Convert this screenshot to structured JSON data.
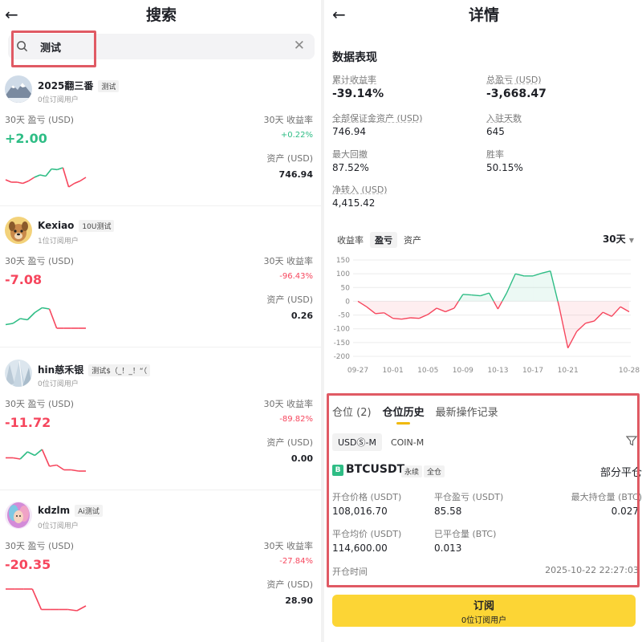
{
  "left": {
    "title": "搜索",
    "search": {
      "value": "测试",
      "placeholder": ""
    },
    "cards": [
      {
        "name": "2025翻三番",
        "tag": "测试",
        "subscribers": "0位订阅用户",
        "pnl_label": "30天 盈亏 (USD)",
        "pnl": "+2.00",
        "pnl_color": "#2ebd85",
        "roi_label": "30天 收益率",
        "roi": "+0.22%",
        "roi_color": "#2ebd85",
        "assets_label": "资产 (USD)",
        "assets": "746.94",
        "avatar": "mountain-avatar",
        "sparkline": [
          {
            "v": 0.3,
            "c": "#f6465d"
          },
          {
            "v": 0.2,
            "c": "#f6465d"
          },
          {
            "v": 0.2,
            "c": "#f6465d"
          },
          {
            "v": 0.15,
            "c": "#f6465d"
          },
          {
            "v": 0.25,
            "c": "#f6465d"
          },
          {
            "v": 0.4,
            "c": "#f6465d"
          },
          {
            "v": 0.5,
            "c": "#2ebd85"
          },
          {
            "v": 0.45,
            "c": "#2ebd85"
          },
          {
            "v": 0.75,
            "c": "#2ebd85"
          },
          {
            "v": 0.72,
            "c": "#2ebd85"
          },
          {
            "v": 0.8,
            "c": "#2ebd85"
          },
          {
            "v": 0.0,
            "c": "#f6465d"
          },
          {
            "v": 0.15,
            "c": "#f6465d"
          },
          {
            "v": 0.25,
            "c": "#f6465d"
          },
          {
            "v": 0.4,
            "c": "#f6465d"
          }
        ]
      },
      {
        "name": "Kexiao",
        "tag": "10U测试",
        "subscribers": "1位订阅用户",
        "pnl_label": "30天 盈亏 (USD)",
        "pnl": "-7.08",
        "pnl_color": "#f6465d",
        "roi_label": "30天 收益率",
        "roi": "-96.43%",
        "roi_color": "#f6465d",
        "assets_label": "资产 (USD)",
        "assets": "0.26",
        "avatar": "dog-avatar",
        "sparkline": [
          {
            "v": 0.15,
            "c": "#2ebd85"
          },
          {
            "v": 0.2,
            "c": "#2ebd85"
          },
          {
            "v": 0.4,
            "c": "#2ebd85"
          },
          {
            "v": 0.35,
            "c": "#2ebd85"
          },
          {
            "v": 0.65,
            "c": "#2ebd85"
          },
          {
            "v": 0.85,
            "c": "#2ebd85"
          },
          {
            "v": 0.8,
            "c": "#2ebd85"
          },
          {
            "v": 0.0,
            "c": "#f6465d"
          },
          {
            "v": 0.0,
            "c": "#f6465d"
          },
          {
            "v": 0.0,
            "c": "#f6465d"
          },
          {
            "v": 0.0,
            "c": "#f6465d"
          },
          {
            "v": 0.0,
            "c": "#f6465d"
          }
        ]
      },
      {
        "name": "hin慈禾银",
        "tag": "测试$（_！_！“（",
        "subscribers": "0位订阅用户",
        "pnl_label": "30天 盈亏 (USD)",
        "pnl": "-11.72",
        "pnl_color": "#f6465d",
        "roi_label": "30天 收益率",
        "roi": "-89.82%",
        "roi_color": "#f6465d",
        "assets_label": "资产 (USD)",
        "assets": "0.00",
        "avatar": "ice-avatar",
        "sparkline": [
          {
            "v": 0.55,
            "c": "#f6465d"
          },
          {
            "v": 0.55,
            "c": "#f6465d"
          },
          {
            "v": 0.5,
            "c": "#f6465d"
          },
          {
            "v": 0.8,
            "c": "#2ebd85"
          },
          {
            "v": 0.65,
            "c": "#2ebd85"
          },
          {
            "v": 0.9,
            "c": "#2ebd85"
          },
          {
            "v": 0.2,
            "c": "#f6465d"
          },
          {
            "v": 0.25,
            "c": "#f6465d"
          },
          {
            "v": 0.05,
            "c": "#f6465d"
          },
          {
            "v": 0.05,
            "c": "#f6465d"
          },
          {
            "v": 0.0,
            "c": "#f6465d"
          },
          {
            "v": 0.0,
            "c": "#f6465d"
          }
        ]
      },
      {
        "name": "kdzlm",
        "tag": "Ai测试",
        "subscribers": "0位订阅用户",
        "pnl_label": "30天 盈亏 (USD)",
        "pnl": "-20.35",
        "pnl_color": "#f6465d",
        "roi_label": "30天 收益率",
        "roi": "-27.84%",
        "roi_color": "#f6465d",
        "assets_label": "资产 (USD)",
        "assets": "28.90",
        "avatar": "portrait-avatar",
        "sparkline": [
          {
            "v": 1.0,
            "c": "#f6465d"
          },
          {
            "v": 1.0,
            "c": "#f6465d"
          },
          {
            "v": 1.0,
            "c": "#f6465d"
          },
          {
            "v": 1.0,
            "c": "#f6465d"
          },
          {
            "v": 0.15,
            "c": "#f6465d"
          },
          {
            "v": 0.15,
            "c": "#f6465d"
          },
          {
            "v": 0.15,
            "c": "#f6465d"
          },
          {
            "v": 0.15,
            "c": "#f6465d"
          },
          {
            "v": 0.1,
            "c": "#f6465d"
          },
          {
            "v": 0.3,
            "c": "#f6465d"
          }
        ]
      }
    ]
  },
  "right": {
    "title": "详情",
    "section_title": "数据表现",
    "metrics": {
      "roi_label": "累计收益率",
      "roi": "-39.14%",
      "total_pnl_label": "总盈亏 (USD)",
      "total_pnl": "-3,668.47",
      "margin_label": "全部保证金资产 (USD)",
      "margin": "746.94",
      "days_label": "入驻天数",
      "days": "645",
      "drawdown_label": "最大回撤",
      "drawdown": "87.52%",
      "winrate_label": "胜率",
      "winrate": "50.15%",
      "netin_label": "净转入 (USD)",
      "netin": "4,415.42"
    },
    "chart_tabs": [
      "收益率",
      "盈亏",
      "资产"
    ],
    "chart_tab_active": 1,
    "period": "30天",
    "tabs": [
      "仓位 (2)",
      "仓位历史",
      "最新操作记录"
    ],
    "tab_active": 1,
    "subtabs": [
      "USDⓈ-M",
      "COIN-M"
    ],
    "subtab_active": 0,
    "position": {
      "symbol_badge": "B",
      "symbol": "BTCUSDT",
      "pill1": "永续",
      "pill2": "全仓",
      "mode": "部分平仓",
      "open_price_label": "开仓价格 (USDT)",
      "open_price": "108,016.70",
      "close_pnl_label": "平仓盈亏 (USDT)",
      "close_pnl": "85.58",
      "max_hold_label": "最大持仓量 (BTC)",
      "max_hold": "0.027",
      "avg_close_label": "平仓均价 (USDT)",
      "avg_close": "114,600.00",
      "closed_qty_label": "已平仓量 (BTC)",
      "closed_qty": "0.013",
      "open_time_label": "开仓时间",
      "open_time": "2025-10-22 22:27:03"
    },
    "subscribe": {
      "label": "订阅",
      "subs": "0位订阅用户"
    }
  },
  "colors": {
    "green": "#2ebd85",
    "red": "#f6465d",
    "accent": "#fcd535",
    "highlight": "#e05a64"
  },
  "chart_data": {
    "type": "line",
    "x": [
      "09-27",
      "09-28",
      "09-29",
      "09-30",
      "10-01",
      "10-02",
      "10-03",
      "10-04",
      "10-05",
      "10-06",
      "10-07",
      "10-08",
      "10-09",
      "10-10",
      "10-11",
      "10-12",
      "10-13",
      "10-14",
      "10-15",
      "10-16",
      "10-17",
      "10-18",
      "10-19",
      "10-20",
      "10-21",
      "10-22",
      "10-23",
      "10-24",
      "10-25",
      "10-26",
      "10-27",
      "10-28"
    ],
    "x_tick_labels": [
      "09-27",
      "10-01",
      "10-05",
      "10-09",
      "10-13",
      "10-17",
      "10-21",
      "10-28"
    ],
    "series": [
      {
        "values": [
          0,
          -20,
          -45,
          -42,
          -62,
          -65,
          -60,
          -62,
          -48,
          -25,
          -38,
          -25,
          25,
          23,
          20,
          30,
          -28,
          30,
          100,
          92,
          92,
          102,
          110,
          -20,
          -170,
          -110,
          -80,
          -72,
          -40,
          -55,
          -20,
          -38
        ]
      }
    ],
    "ylim": [
      -200,
      150
    ],
    "yticks": [
      150,
      100,
      50,
      0,
      -50,
      -100,
      -150,
      -200
    ],
    "colors": {
      "positive": "#2ebd85",
      "negative": "#f6465d"
    }
  }
}
